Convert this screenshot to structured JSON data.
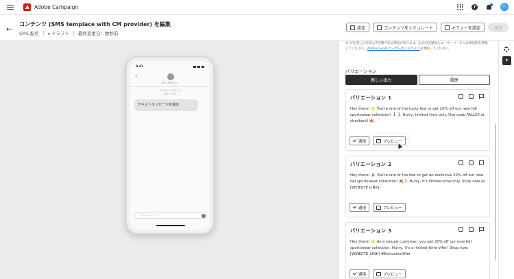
{
  "app": {
    "name": "Adobe Campaign"
  },
  "header": {
    "title": "コンテンツ (SMS templace with CM provider) を編集",
    "channel": "SMS 配信",
    "status": "ドラフト",
    "modified": "最終変更日：数秒前",
    "buttons": {
      "settings": "設定",
      "simulate": "コンテンツをシミュレート",
      "offers": "オファーを設定",
      "save": "保存"
    }
  },
  "phone": {
    "time": "9:41",
    "contact": "ホバリのテスト",
    "subtitle": "テキストメッセージ\n今日：9:41",
    "bubble": "テキストメッセージを追加",
    "input_placeholder": "テキストメッセージ"
  },
  "panel": {
    "disclaimer_pre": "AI が生成した応答は不正確である場合があります。出力の正確性とユーザーベースへの適切性を評価してください。",
    "disclaimer_link": "Adobe GenAI ユーザーガイドライン",
    "disclaimer_post": "を参照してください。",
    "variations_label": "バリエーション",
    "tabs": {
      "new": "新しい出力",
      "history": "履歴"
    },
    "apply_label": "適用",
    "preview_label": "プレビュー",
    "variations": [
      {
        "title": "バリエーション 1",
        "text": "Hey there! 🌟 You're one of the lucky few to get 20% off our new fall sportswear collection! 🏃‍♀️🏃 Hurry, limited time only. Use code FALL20 at checkout! 🍂"
      },
      {
        "title": "バリエーション 2",
        "text": "Hey there! 🎉 You're one of the few to get an exclusive 20% off our new fall sportswear collection! 🍂🏃 Hurry, it's limited-time only. Shop now at [WEBSITE LINK]!"
      },
      {
        "title": "バリエーション 3",
        "text": "Hey there! 🌟 As a valued customer, you get 20% off our new fall sportswear collection. Hurry, it's a limited-time offer! Shop now: [WEBSITE_LINK] #ExclusiveOffer"
      }
    ]
  }
}
